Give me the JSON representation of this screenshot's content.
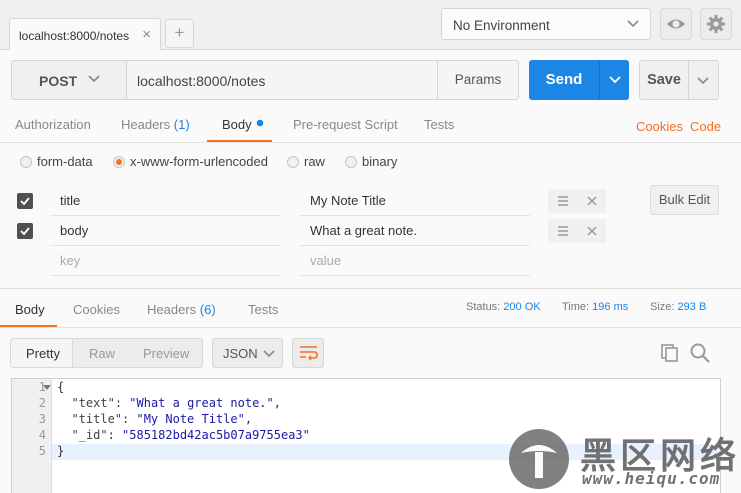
{
  "tabs": {
    "active_tab_label": "localhost:8000/notes",
    "add_label": "+"
  },
  "environment": {
    "selected": "No Environment"
  },
  "request": {
    "method": "POST",
    "url": "localhost:8000/notes",
    "params_label": "Params",
    "send_label": "Send",
    "save_label": "Save"
  },
  "request_tabs": [
    {
      "label": "Authorization"
    },
    {
      "label": "Headers",
      "count": "(1)"
    },
    {
      "label": "Body"
    },
    {
      "label": "Pre-request Script"
    },
    {
      "label": "Tests"
    }
  ],
  "links": {
    "cookies": "Cookies",
    "code": "Code"
  },
  "body_types": [
    "form-data",
    "x-www-form-urlencoded",
    "raw",
    "binary"
  ],
  "body_type_selected": "x-www-form-urlencoded",
  "form_rows": [
    {
      "key": "title",
      "value": "My Note Title",
      "checked": true
    },
    {
      "key": "body",
      "value": "What a great note.",
      "checked": true
    }
  ],
  "form_placeholders": {
    "key": "key",
    "value": "value"
  },
  "bulk_edit_label": "Bulk Edit",
  "response_tabs": [
    {
      "label": "Body"
    },
    {
      "label": "Cookies"
    },
    {
      "label": "Headers",
      "count": "(6)"
    },
    {
      "label": "Tests"
    }
  ],
  "response_meta": {
    "status_label": "Status:",
    "status_value": "200 OK",
    "time_label": "Time:",
    "time_value": "196 ms",
    "size_label": "Size:",
    "size_value": "293 B"
  },
  "view_modes": [
    "Pretty",
    "Raw",
    "Preview"
  ],
  "format_selected": "JSON",
  "code_lines": [
    {
      "num": "1",
      "text": "{"
    },
    {
      "num": "2",
      "key": "\"text\"",
      "val": "\"What a great note.\"",
      "comma": ","
    },
    {
      "num": "3",
      "key": "\"title\"",
      "val": "\"My Note Title\"",
      "comma": ","
    },
    {
      "num": "4",
      "key": "\"_id\"",
      "val": "\"585182bd42ac5b07a9755ea3\"",
      "comma": ""
    },
    {
      "num": "5",
      "text": "}"
    }
  ],
  "watermark": {
    "text": "黑区网络",
    "url": "www.heiqu.com"
  },
  "colors": {
    "accent_blue": "#1b86e3",
    "accent_orange": "#f47023"
  }
}
